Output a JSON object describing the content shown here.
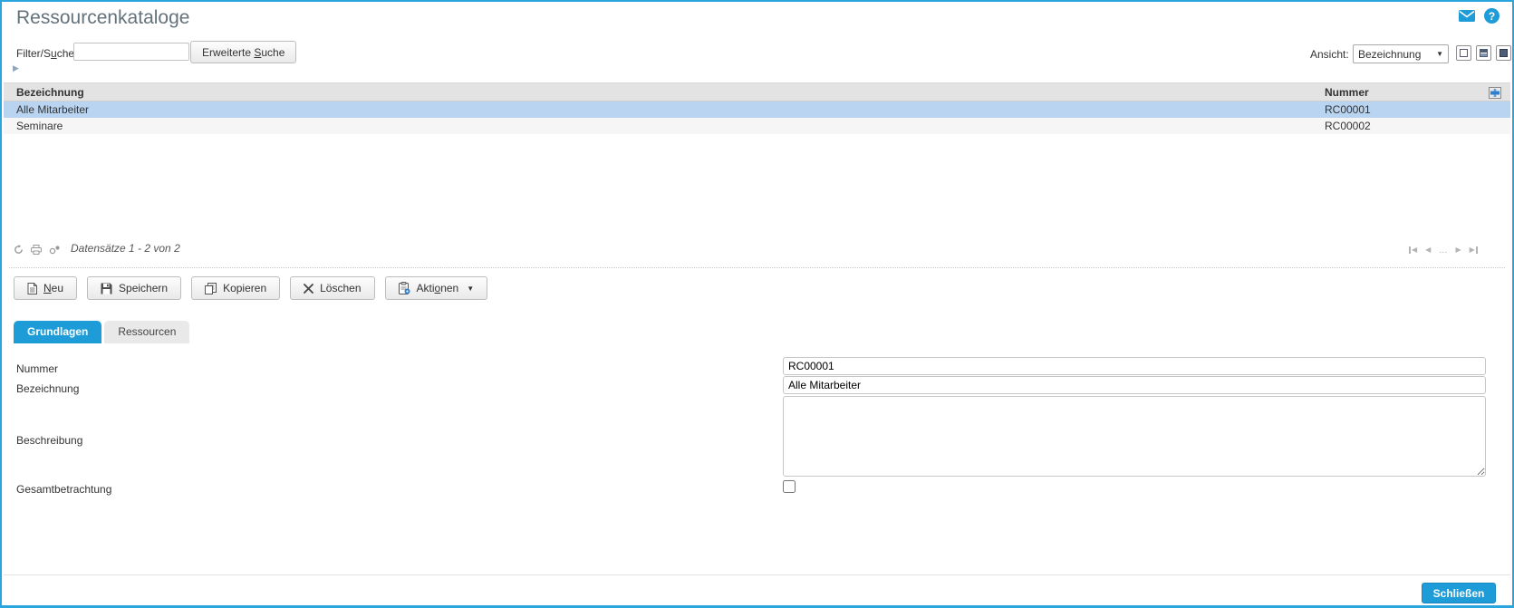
{
  "window": {
    "title": "Ressourcenkataloge"
  },
  "titlebar": {
    "help_glyph": "?"
  },
  "filter": {
    "label_pre": "Filter/S",
    "label_key": "u",
    "label_post": "che:",
    "input_value": "",
    "advanced_pre": "Erweiterte ",
    "advanced_key": "S",
    "advanced_post": "uche"
  },
  "view": {
    "label": "Ansicht:",
    "selected": "Bezeichnung",
    "caret": "▼"
  },
  "expander_glyph": "▶",
  "table": {
    "header": {
      "bezeichnung": "Bezeichnung",
      "nummer": "Nummer"
    },
    "rows": [
      {
        "bezeichnung": "Alle Mitarbeiter",
        "nummer": "RC00001",
        "selected": true
      },
      {
        "bezeichnung": "Seminare",
        "nummer": "RC00002",
        "selected": false
      }
    ]
  },
  "status": {
    "records": "Datensätze 1 - 2 von 2"
  },
  "pagination": {
    "first": "◀",
    "prev": "◀",
    "ellipsis": "...",
    "next": "▶",
    "last": "▶"
  },
  "toolbar": {
    "neu": {
      "key": "N",
      "post": "eu"
    },
    "speichern": "Speichern",
    "kopieren": "Kopieren",
    "loeschen": "Löschen",
    "aktionen": {
      "pre": "Akti",
      "key": "o",
      "post": "nen"
    },
    "caret": "▼"
  },
  "tabs": {
    "grundlagen": "Grundlagen",
    "ressourcen": "Ressourcen"
  },
  "form": {
    "nummer_label": "Nummer",
    "nummer_value": "RC00001",
    "bezeichnung_label": "Bezeichnung",
    "bezeichnung_value": "Alle Mitarbeiter",
    "beschreibung_label": "Beschreibung",
    "beschreibung_value": "",
    "gesamtbetrachtung_label": "Gesamtbetrachtung",
    "gesamtbetrachtung_checked": false
  },
  "footer": {
    "close": "Schließen"
  },
  "colors": {
    "accent": "#1e9cd8",
    "window_border": "#2aa5de",
    "selected_row": "#b9d4f0",
    "table_header_bg": "#e3e3e3"
  }
}
